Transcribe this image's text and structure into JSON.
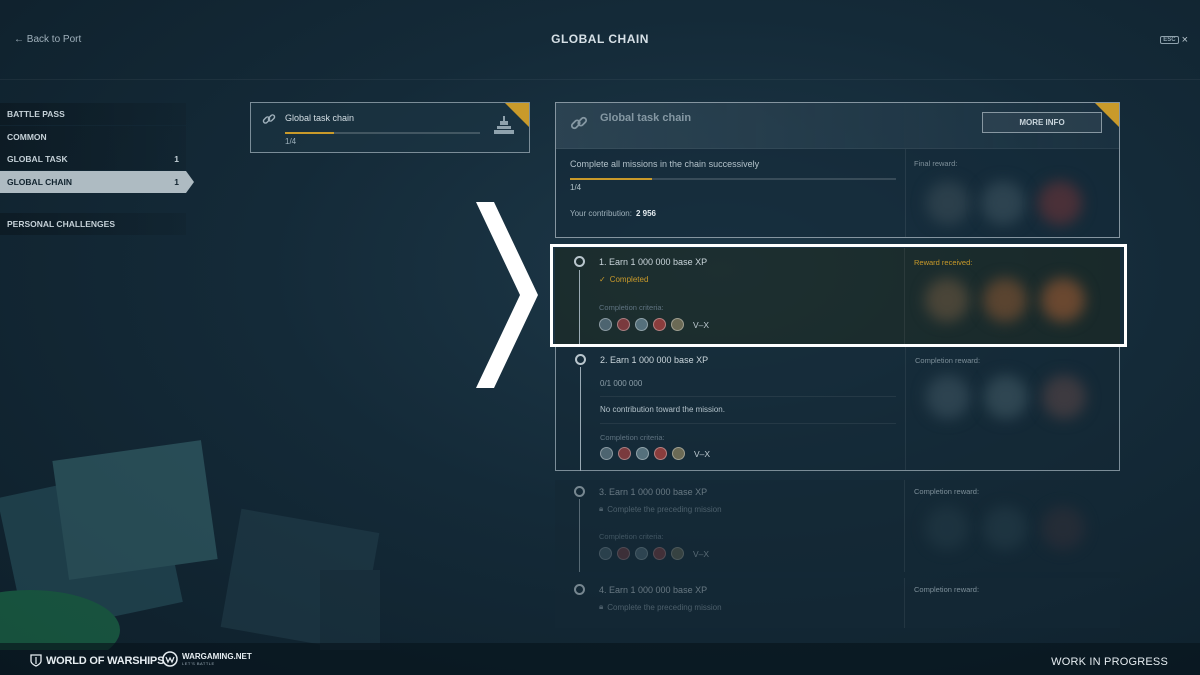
{
  "header": {
    "back_label": "← Back to Port",
    "title": "GLOBAL CHAIN",
    "esc_label": "ESC",
    "close_glyph": "×"
  },
  "sidebar": {
    "items": [
      {
        "label": "BATTLE PASS",
        "count": ""
      },
      {
        "label": "COMMON",
        "count": ""
      },
      {
        "label": "GLOBAL TASK",
        "count": "1"
      },
      {
        "label": "GLOBAL CHAIN",
        "count": "1"
      },
      {
        "label": "PERSONAL CHALLENGES",
        "count": ""
      }
    ]
  },
  "chain_card": {
    "name": "Global task chain",
    "progress_text": "1/4",
    "progress": 0.25,
    "icon": "ship-icon"
  },
  "chain_panel": {
    "name": "Global task chain",
    "more_info_label": "MORE INFO",
    "description": "Complete all missions in the chain successively",
    "progress_text": "1/4",
    "progress": 0.25,
    "contribution_label": "Your contribution:",
    "contribution_value": "2 956",
    "final_reward_label": "Final reward:"
  },
  "missions": [
    {
      "title": "1. Earn 1 000 000 base XP",
      "status": "Completed",
      "criteria_label": "Completion criteria:",
      "tier": "V–X",
      "reward_label": "Reward received:"
    },
    {
      "title": "2. Earn 1 000 000 base XP",
      "progress_text": "0/1 000 000",
      "contribution_text": "No contribution toward the mission.",
      "criteria_label": "Completion criteria:",
      "tier": "V–X",
      "reward_label": "Completion reward:"
    },
    {
      "title": "3. Earn 1 000 000 base XP",
      "lock_text": "Complete the preceding mission",
      "criteria_label": "Completion criteria:",
      "tier": "V–X",
      "reward_label": "Completion reward:"
    },
    {
      "title": "4. Earn 1 000 000 base XP",
      "lock_text": "Complete the preceding mission",
      "reward_label": "Completion reward:"
    }
  ],
  "footer": {
    "game_logo": "WORLD OF WARSHIPS",
    "publisher_logo": "WARGAMING.NET",
    "publisher_tagline": "LET'S BATTLE",
    "status": "WORK IN PROGRESS"
  },
  "colors": {
    "accent_gold": "#c99a2a",
    "background": "#142a38",
    "highlight": "#ffffff"
  }
}
